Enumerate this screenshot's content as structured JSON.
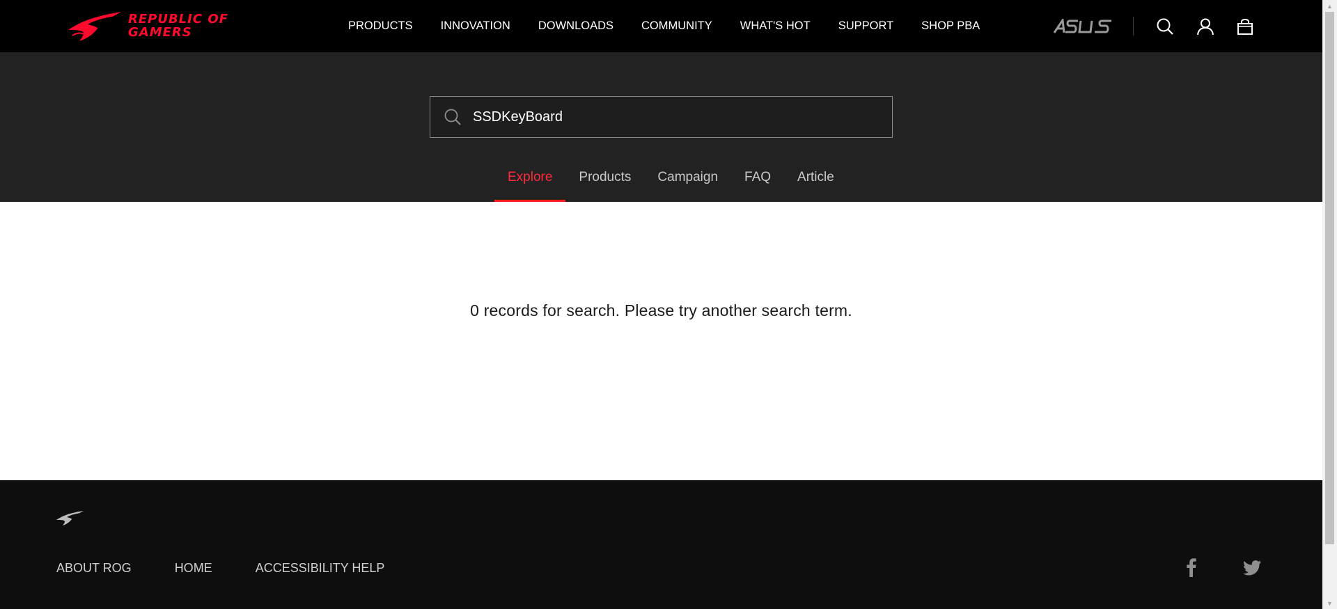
{
  "header": {
    "logo_text_line1": "REPUBLIC OF",
    "logo_text_line2": "GAMERS",
    "nav": [
      {
        "label": "PRODUCTS"
      },
      {
        "label": "INNOVATION"
      },
      {
        "label": "DOWNLOADS"
      },
      {
        "label": "COMMUNITY"
      },
      {
        "label": "WHAT'S HOT"
      },
      {
        "label": "SUPPORT"
      },
      {
        "label": "SHOP PBA"
      }
    ],
    "icons": [
      "asus-logo",
      "search-icon",
      "user-icon",
      "shopping-bag-icon"
    ]
  },
  "search": {
    "query": "SSDKeyBoard",
    "icon": "search-icon"
  },
  "tabs": [
    {
      "label": "Explore",
      "active": true
    },
    {
      "label": "Products",
      "active": false
    },
    {
      "label": "Campaign",
      "active": false
    },
    {
      "label": "FAQ",
      "active": false
    },
    {
      "label": "Article",
      "active": false
    }
  ],
  "results": {
    "message": "0 records for search. Please try another search term."
  },
  "footer": {
    "links": [
      {
        "label": "ABOUT ROG"
      },
      {
        "label": "HOME"
      },
      {
        "label": "ACCESSIBILITY HELP"
      }
    ],
    "social": [
      "facebook-icon",
      "twitter-icon"
    ]
  },
  "colors": {
    "brand_red": "#ff0a2c",
    "active_tab": "#ff2a3c",
    "header_bg": "#000000",
    "search_band_bg": "#222222",
    "footer_bg": "#0e0e0e"
  }
}
